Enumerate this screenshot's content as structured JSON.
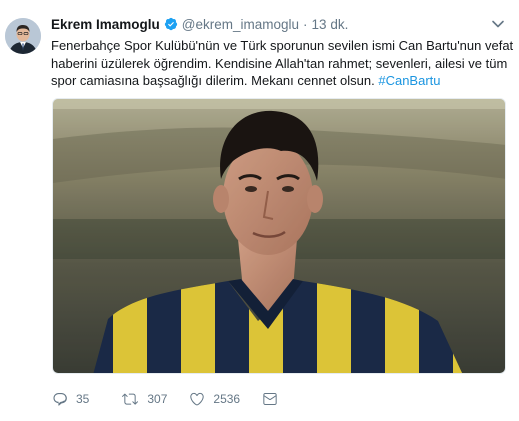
{
  "tweet": {
    "display_name": "Ekrem Imamoglu",
    "handle": "@ekrem_imamoglu",
    "separator": "·",
    "time": "13 dk.",
    "verified_icon": "verified-badge-icon",
    "caret_icon": "chevron-down-icon",
    "text_lines": [
      "Fenerbahçe Spor Kulübü'nün ve Türk sporunun sevilen ismi Can Bartu'nun vefat",
      "haberini üzülerek öğrendim. Kendisine Allah'tan rahmet;  sevenleri, ailesi ve tüm",
      "spor camiasına başsağlığı dilerim. Mekanı cennet olsun. "
    ],
    "hashtag": "#CanBartu",
    "media_icon": "photo-of-footballer",
    "actions": {
      "reply_count": "35",
      "retweet_count": "307",
      "like_count": "2536"
    }
  },
  "colors": {
    "accent": "#1b95e0",
    "muted": "#657786",
    "text": "#14171a",
    "kit_yellow": "#e8cf3a",
    "kit_navy": "#1a2a4a"
  }
}
